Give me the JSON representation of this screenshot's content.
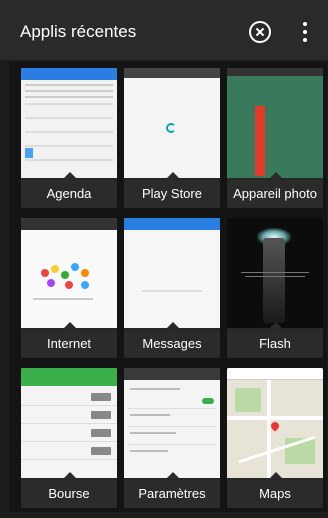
{
  "header": {
    "title": "Applis récentes",
    "close_icon": "close-circle-icon",
    "menu_icon": "overflow-menu-icon"
  },
  "apps": [
    {
      "label": "Agenda"
    },
    {
      "label": "Play Store"
    },
    {
      "label": "Appareil photo"
    },
    {
      "label": "Internet"
    },
    {
      "label": "Messages"
    },
    {
      "label": "Flash"
    },
    {
      "label": "Bourse"
    },
    {
      "label": "Paramètres"
    },
    {
      "label": "Maps"
    }
  ],
  "colors": {
    "background": "#1c1c1c",
    "header": "#2a2a2a",
    "agenda_accent": "#2a7de1",
    "bourse_accent": "#3bb04a"
  }
}
